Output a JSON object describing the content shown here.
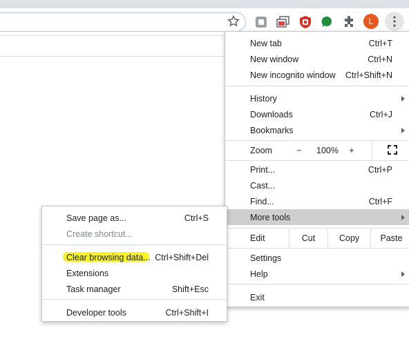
{
  "colors": {
    "accent": "#1a73e8",
    "hover": "#cfcfcf",
    "highlighter": "#f5f212",
    "avatar_bg": "#e8581c"
  },
  "toolbar": {
    "profile_initial": "L",
    "icons": [
      "bookmark-star-icon",
      "extension-icon-1",
      "extension-icon-2",
      "ublock-icon",
      "green-extension-icon",
      "puzzle-extensions-icon",
      "kebab-menu-icon"
    ]
  },
  "main_menu": {
    "new_tab": {
      "label": "New tab",
      "shortcut": "Ctrl+T"
    },
    "new_window": {
      "label": "New window",
      "shortcut": "Ctrl+N"
    },
    "new_incognito": {
      "label": "New incognito window",
      "shortcut": "Ctrl+Shift+N"
    },
    "history": {
      "label": "History"
    },
    "downloads": {
      "label": "Downloads",
      "shortcut": "Ctrl+J"
    },
    "bookmarks": {
      "label": "Bookmarks"
    },
    "zoom": {
      "label": "Zoom",
      "minus": "−",
      "value": "100%",
      "plus": "+"
    },
    "print": {
      "label": "Print...",
      "shortcut": "Ctrl+P"
    },
    "cast": {
      "label": "Cast..."
    },
    "find": {
      "label": "Find...",
      "shortcut": "Ctrl+F"
    },
    "more_tools": {
      "label": "More tools"
    },
    "edit": {
      "label": "Edit",
      "cut": "Cut",
      "copy": "Copy",
      "paste": "Paste"
    },
    "settings": {
      "label": "Settings"
    },
    "help": {
      "label": "Help"
    },
    "exit": {
      "label": "Exit"
    }
  },
  "sub_menu": {
    "save_page": {
      "label": "Save page as...",
      "shortcut": "Ctrl+S"
    },
    "create_shortcut": {
      "label": "Create shortcut..."
    },
    "clear_browsing": {
      "label": "Clear browsing data...",
      "shortcut": "Ctrl+Shift+Del"
    },
    "extensions": {
      "label": "Extensions"
    },
    "task_manager": {
      "label": "Task manager",
      "shortcut": "Shift+Esc"
    },
    "developer_tools": {
      "label": "Developer tools",
      "shortcut": "Ctrl+Shift+I"
    }
  }
}
